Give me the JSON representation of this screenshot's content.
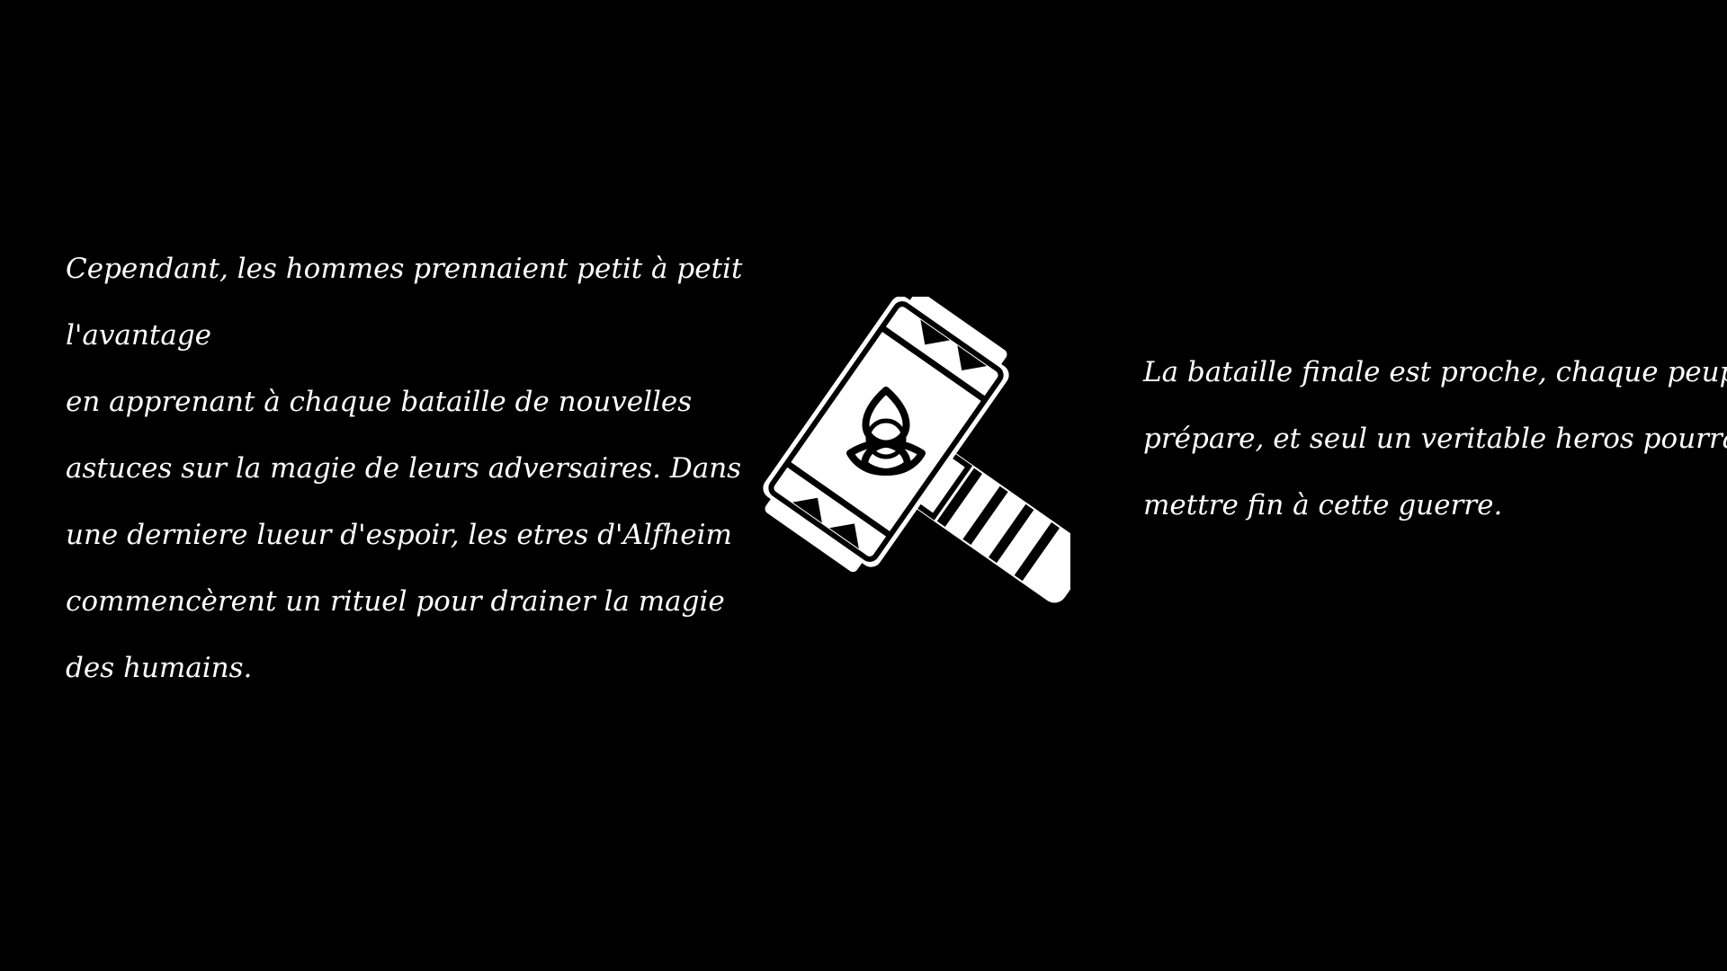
{
  "colors": {
    "background": "#000000",
    "text": "#ffffff",
    "hammer": "#ffffff"
  },
  "story": {
    "left_lines": [
      "Cependant, les hommes prennaient petit à petit",
      "l'avantage",
      "en apprenant à chaque bataille de nouvelles",
      "astuces sur la magie de leurs adversaires. Dans",
      "une derniere lueur d'espoir, les etres d'Alfheim",
      "commencèrent un rituel pour drainer la magie",
      "des humains."
    ],
    "right_lines": [
      "La bataille finale est proche, chaque peuple se",
      "prépare, et seul un veritable heros pourras",
      "mettre fin à cette guerre."
    ]
  },
  "illustration": {
    "icon": "hammer-icon",
    "symbol": "triquetra-icon"
  }
}
